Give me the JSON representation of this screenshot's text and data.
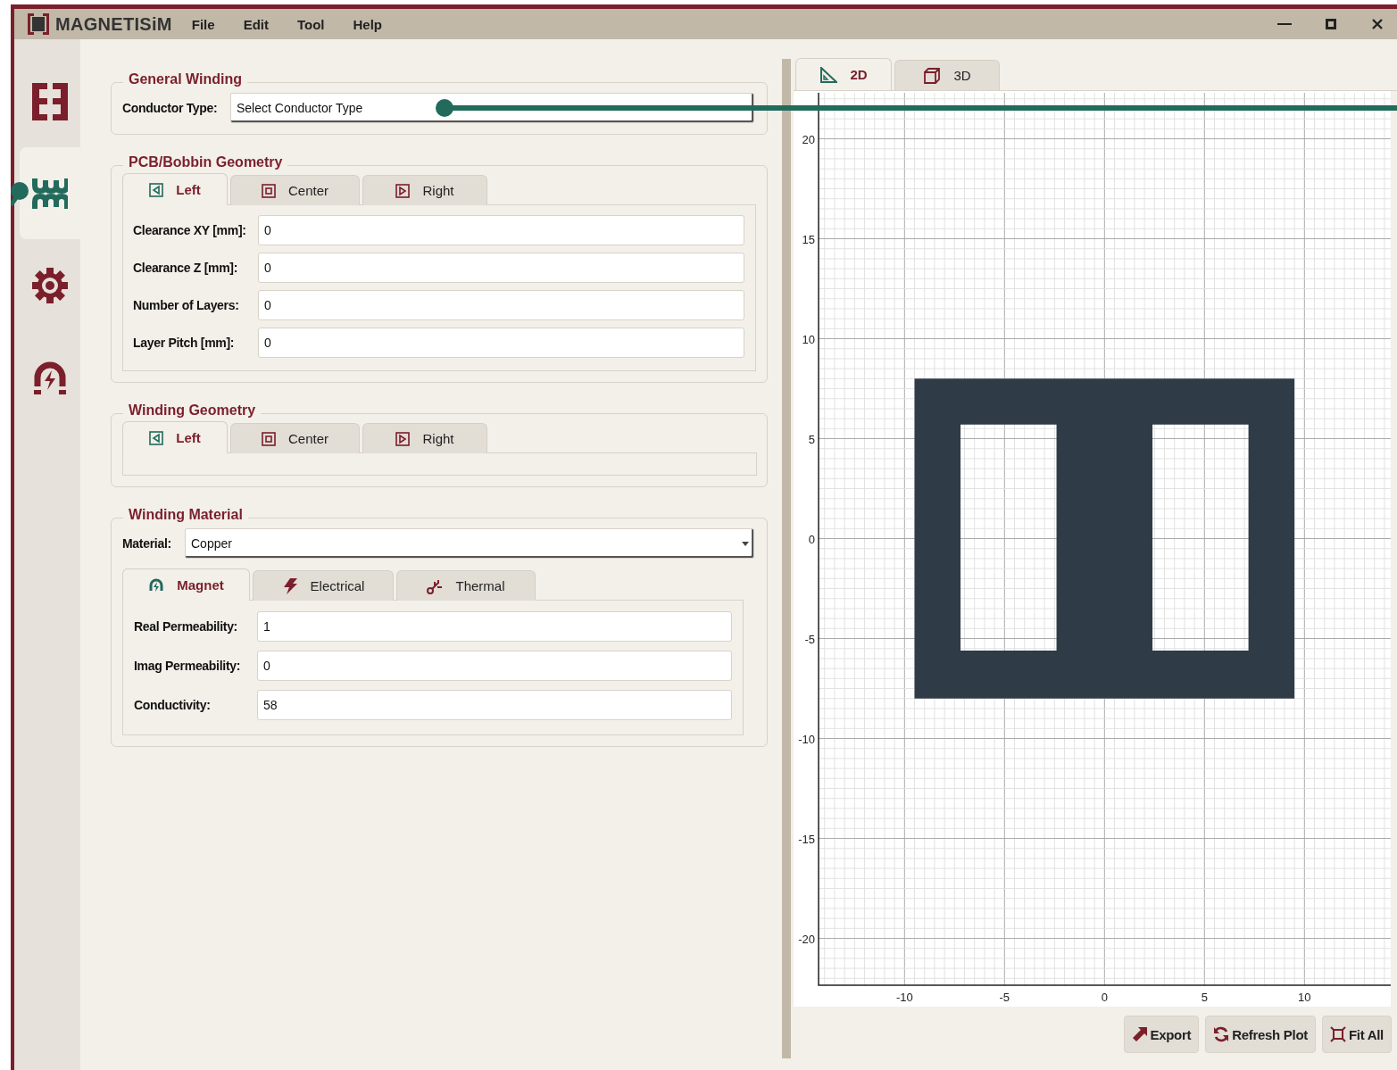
{
  "window": {
    "app_name": "MAGNETISiM",
    "menu": [
      "File",
      "Edit",
      "Tool",
      "Help"
    ]
  },
  "sidebar": {
    "items": [
      {
        "kind": "core",
        "selected": false
      },
      {
        "kind": "winding",
        "selected": true
      },
      {
        "kind": "settings",
        "selected": false
      },
      {
        "kind": "magnet",
        "selected": false
      }
    ]
  },
  "general_winding": {
    "title": "General Winding",
    "conductor_type": {
      "label": "Conductor Type:",
      "value": "Select Conductor Type"
    }
  },
  "pcb_bobbin_geometry": {
    "title": "PCB/Bobbin Geometry",
    "tabs": [
      {
        "label": "Left",
        "kind": "left",
        "selected": true
      },
      {
        "label": "Center",
        "kind": "center",
        "selected": false
      },
      {
        "label": "Right",
        "kind": "right",
        "selected": false
      }
    ],
    "fields": [
      {
        "label": "Clearance XY [mm]:",
        "value": "0"
      },
      {
        "label": "Clearance Z [mm]:",
        "value": "0"
      },
      {
        "label": "Number of Layers:",
        "value": "0"
      },
      {
        "label": "Layer Pitch [mm]:",
        "value": "0"
      }
    ]
  },
  "winding_geometry": {
    "title": "Winding Geometry",
    "tabs": [
      {
        "label": "Left",
        "kind": "left",
        "selected": true
      },
      {
        "label": "Center",
        "kind": "center",
        "selected": false
      },
      {
        "label": "Right",
        "kind": "right",
        "selected": false
      }
    ]
  },
  "winding_material": {
    "title": "Winding Material",
    "material": {
      "label": "Material:",
      "value": "Copper"
    },
    "tabs": [
      {
        "label": "Magnet",
        "kind": "magnet",
        "selected": true
      },
      {
        "label": "Electrical",
        "kind": "electrical",
        "selected": false
      },
      {
        "label": "Thermal",
        "kind": "thermal",
        "selected": false
      }
    ],
    "fields": [
      {
        "label": "Real Permeability:",
        "value": "1"
      },
      {
        "label": "Imag Permeability:",
        "value": "0"
      },
      {
        "label": "Conductivity:",
        "value": "58"
      }
    ]
  },
  "view_tabs": [
    {
      "label": "2D",
      "kind": "planar",
      "selected": true
    },
    {
      "label": "3D",
      "kind": "solid",
      "selected": false
    }
  ],
  "plot": {
    "xticks": [
      "-10",
      "-5",
      "0",
      "5",
      "10"
    ],
    "yticks": [
      "20",
      "15",
      "10",
      "5",
      "0",
      "-5",
      "-10",
      "-15",
      "-20"
    ]
  },
  "buttons": [
    {
      "label": "Export",
      "kind": "export"
    },
    {
      "label": "Refresh Plot",
      "kind": "refresh"
    },
    {
      "label": "Fit All",
      "kind": "fit"
    }
  ]
}
